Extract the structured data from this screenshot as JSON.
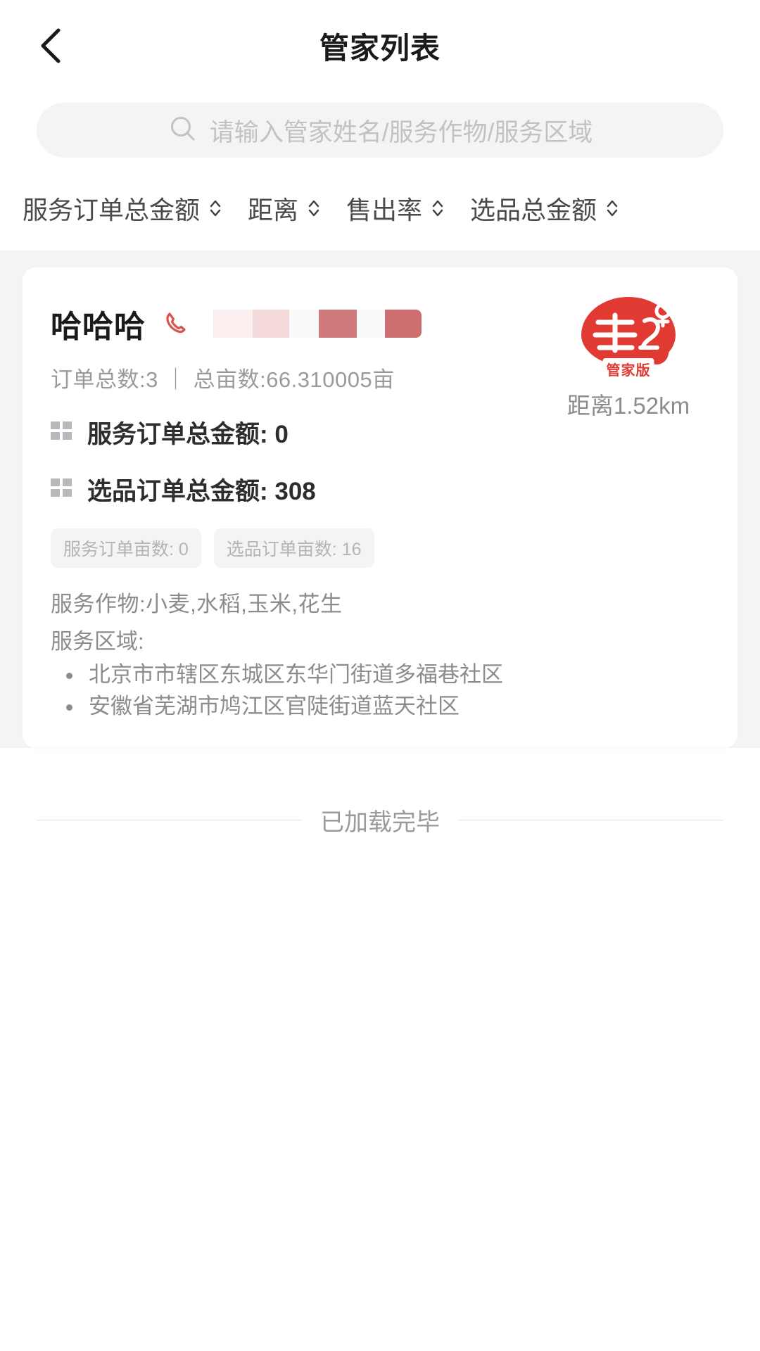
{
  "header": {
    "title": "管家列表",
    "back_icon": "chevron-left-icon"
  },
  "search": {
    "icon": "search-icon",
    "placeholder": "请输入管家姓名/服务作物/服务区域",
    "value": ""
  },
  "sort_tabs": [
    {
      "label": "服务订单总金额",
      "icon": "sort-updown-icon"
    },
    {
      "label": "距离",
      "icon": "sort-updown-icon"
    },
    {
      "label": "售出率",
      "icon": "sort-updown-icon"
    },
    {
      "label": "选品总金额",
      "icon": "sort-updown-icon"
    }
  ],
  "card": {
    "name": "哈哈哈",
    "phone_icon": "phone-icon",
    "phone_masked": "",
    "meta": "订单总数:3 ｜ 总亩数:66.310005亩",
    "service_amount_label": "服务订单总金额: 0",
    "product_amount_label": "选品订单总金额: 308",
    "chips": [
      "服务订单亩数: 0",
      "选品订单亩数: 16"
    ],
    "crops": "服务作物:小麦,水稻,玉米,花生",
    "regions_label": "服务区域:",
    "regions": [
      "北京市市辖区东城区东华门街道多福巷社区",
      "安徽省芜湖市鸠江区官陡街道蓝天社区"
    ],
    "logo_badge": {
      "brand_char": "丰",
      "sub_text": "管家版",
      "color": "#e03a32"
    },
    "distance": "距离1.52km"
  },
  "footer": {
    "text": "已加载完毕"
  },
  "colors": {
    "accent": "#e03a32",
    "page_bg": "#ffffff",
    "list_bg": "#f4f4f5",
    "text_primary": "#1a1a1a",
    "text_muted": "#8c8c90"
  }
}
